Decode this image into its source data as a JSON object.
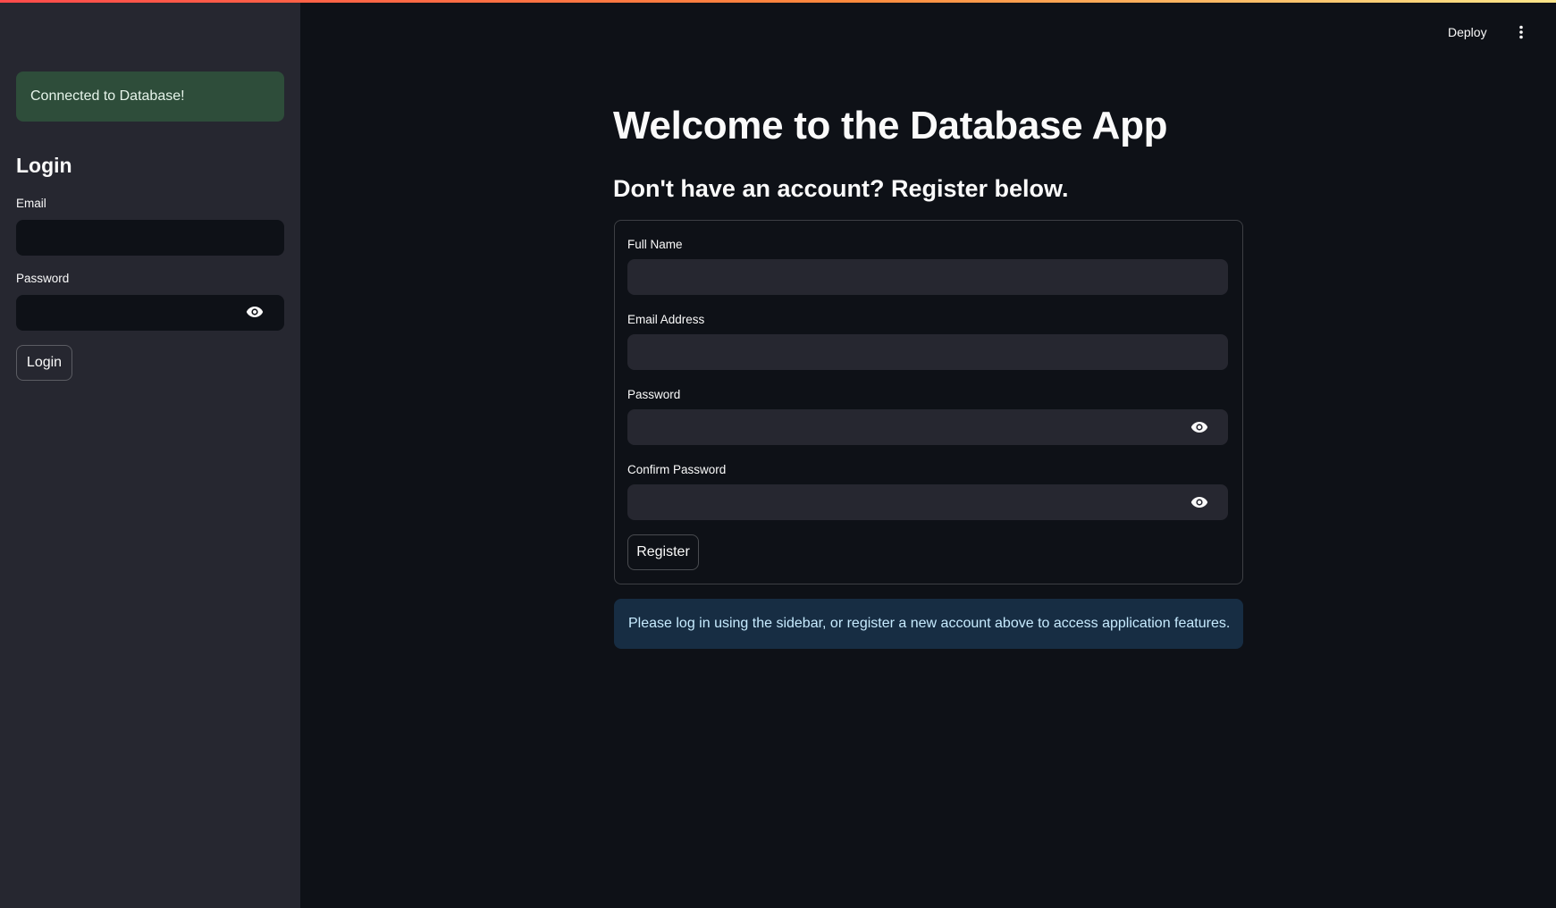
{
  "header": {
    "deploy_label": "Deploy",
    "menu_icon": "kebab-menu-icon"
  },
  "sidebar": {
    "status_message": "Connected to Database!",
    "status_color": "#2e4d3a",
    "login_heading": "Login",
    "email_label": "Email",
    "email_value": "",
    "password_label": "Password",
    "password_value": "",
    "password_toggle_icon": "eye-icon",
    "login_button": "Login"
  },
  "main": {
    "title": "Welcome to the Database App",
    "subtitle": "Don't have an account? Register below.",
    "form": {
      "full_name_label": "Full Name",
      "full_name_value": "",
      "email_label": "Email Address",
      "email_value": "",
      "password_label": "Password",
      "password_value": "",
      "confirm_password_label": "Confirm Password",
      "confirm_password_value": "",
      "password_toggle_icon": "eye-icon",
      "register_button": "Register"
    },
    "info_message": "Please log in using the sidebar, or register a new account above to access application features.",
    "info_color": "#172d43"
  },
  "theme": {
    "background": "#0e1117",
    "sidebar_background": "#262730",
    "accent": "#ff4b4b"
  }
}
